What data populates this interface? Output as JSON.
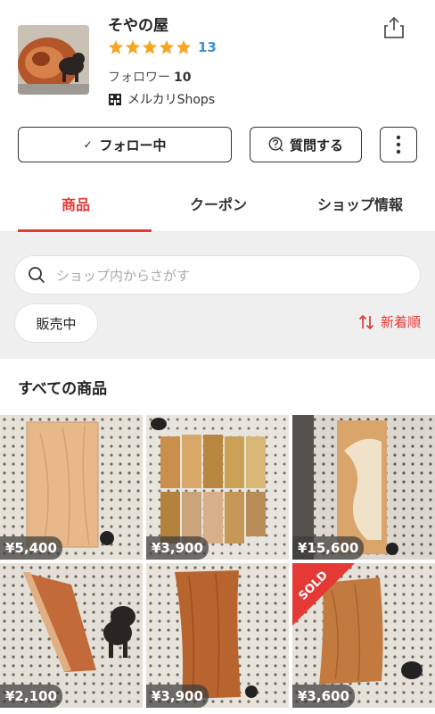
{
  "shop": {
    "name": "そやの屋",
    "rating_count": "13",
    "followers_label": "フォロワー",
    "followers_count": "10",
    "platform": "メルカリShops"
  },
  "actions": {
    "follow": "フォロー中",
    "follow_check": "✓",
    "ask": "質問する"
  },
  "tabs": [
    {
      "label": "商品"
    },
    {
      "label": "クーポン"
    },
    {
      "label": "ショップ情報"
    }
  ],
  "search": {
    "placeholder": "ショップ内からさがす"
  },
  "filter": {
    "label": "販売中"
  },
  "sort": {
    "label": "新着順"
  },
  "section_title": "すべての商品",
  "products": [
    {
      "price": "¥5,400"
    },
    {
      "price": "¥3,900"
    },
    {
      "price": "¥15,600"
    },
    {
      "price": "¥2,100"
    },
    {
      "price": "¥3,900"
    },
    {
      "price": "¥3,600",
      "sold": "SOLD"
    }
  ],
  "colors": {
    "accent": "#e53935",
    "rating": "#3a8fd6",
    "star": "#f5a623"
  }
}
